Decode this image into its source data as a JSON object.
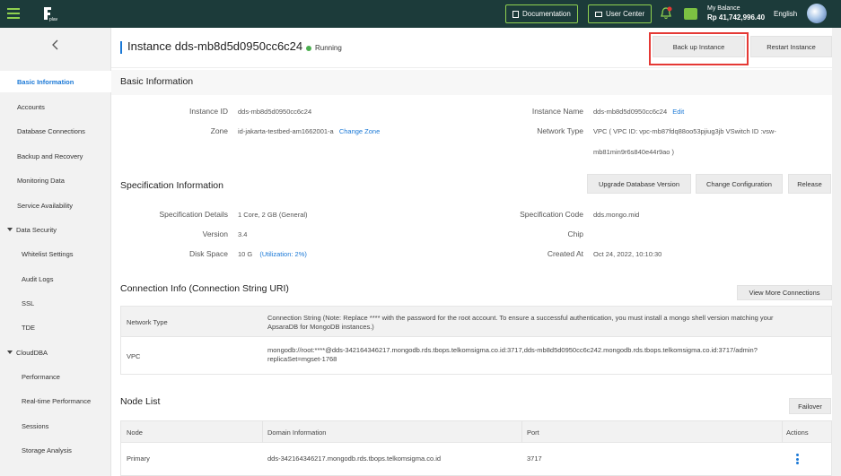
{
  "topbar": {
    "documentation": "Documentation",
    "user_center": "User Center",
    "balance_label": "My Balance",
    "balance_amount": "Rp 41,742,996.40",
    "language": "English",
    "logo_text": "plav"
  },
  "sidebar": {
    "items": [
      {
        "label": "Basic Information",
        "active": true
      },
      {
        "label": "Accounts"
      },
      {
        "label": "Database Connections"
      },
      {
        "label": "Backup and Recovery"
      },
      {
        "label": "Monitoring Data"
      },
      {
        "label": "Service Availability"
      },
      {
        "label": "Data Security",
        "group": true
      },
      {
        "label": "Whitelist Settings",
        "child": true
      },
      {
        "label": "Audit Logs",
        "child": true
      },
      {
        "label": "SSL",
        "child": true
      },
      {
        "label": "TDE",
        "child": true
      },
      {
        "label": "CloudDBA",
        "group": true
      },
      {
        "label": "Performance",
        "child": true
      },
      {
        "label": "Real-time Performance",
        "child": true
      },
      {
        "label": "Sessions",
        "child": true
      },
      {
        "label": "Storage Analysis",
        "child": true
      }
    ]
  },
  "header": {
    "title": "Instance dds-mb8d5d0950cc6c24",
    "status": "Running",
    "backup_button": "Back up Instance",
    "restart_button": "Restart Instance"
  },
  "basic": {
    "title": "Basic Information",
    "instance_id_label": "Instance ID",
    "instance_id": "dds-mb8d5d0950cc6c24",
    "instance_name_label": "Instance Name",
    "instance_name": "dds-mb8d5d0950cc6c24",
    "edit": "Edit",
    "zone_label": "Zone",
    "zone": "id-jakarta-testbed-am1662001-a",
    "change_zone": "Change Zone",
    "network_type_label": "Network Type",
    "network_type_line1": "VPC ( VPC ID: vpc-mb87fdq88oo53pjiug3jb VSwitch ID :vsw-",
    "network_type_line2": "mb81min9r6s840e44r9ao )"
  },
  "spec": {
    "title": "Specification Information",
    "upgrade_button": "Upgrade Database Version",
    "change_button": "Change Configuration",
    "release_button": "Release",
    "details_label": "Specification Details",
    "details": "1 Core, 2 GB (General)",
    "code_label": "Specification Code",
    "code": "dds.mongo.mid",
    "version_label": "Version",
    "version": "3.4",
    "chip_label": "Chip",
    "disk_label": "Disk Space",
    "disk": "10 G",
    "utilization": "(Utilization: 2%)",
    "created_label": "Created At",
    "created": "Oct 24, 2022, 10:10:30"
  },
  "connection": {
    "title": "Connection Info (Connection String URI)",
    "view_more": "View More Connections",
    "col_network": "Network Type",
    "col_string_line1": "Connection String (Note: Replace **** with the password for the root account. To ensure a successful authentication, you must install a mongo shell version matching your",
    "col_string_line2": "ApsaraDB for MongoDB instances.)",
    "row_network": "VPC",
    "row_string_line1": "mongodb://root:****@dds-342164346217.mongodb.rds.tbops.telkomsigma.co.id:3717,dds-mb8d5d0950cc6c242.mongodb.rds.tbops.telkomsigma.co.id:3717/admin?",
    "row_string_line2": "replicaSet=mgset-1768"
  },
  "nodes": {
    "title": "Node List",
    "failover": "Failover",
    "col_node": "Node",
    "col_domain": "Domain Information",
    "col_port": "Port",
    "col_actions": "Actions",
    "row_node": "Primary",
    "row_domain": "dds-342164346217.mongodb.rds.tbops.telkomsigma.co.id",
    "row_port": "3717"
  }
}
